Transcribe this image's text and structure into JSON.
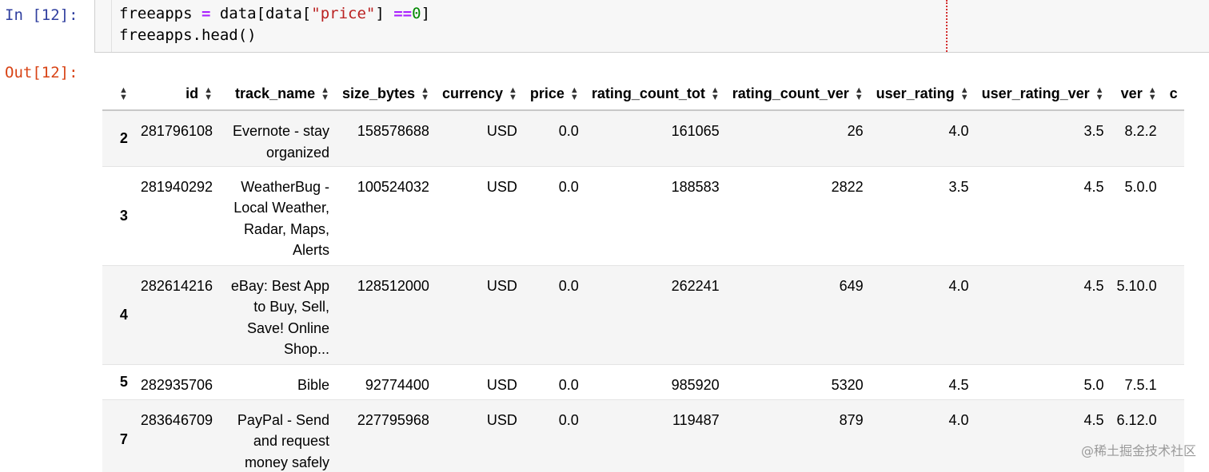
{
  "input_cell": {
    "prompt": "In [12]:",
    "line1": {
      "a": "freeapps ",
      "eq": "=",
      "b": " data[data[",
      "str": "\"price\"",
      "c": "] ",
      "op": "==",
      "num": "0",
      "d": "]"
    },
    "line2": "freeapps.head()"
  },
  "output_cell": {
    "prompt": "Out[12]:",
    "columns": [
      "",
      "id",
      "track_name",
      "size_bytes",
      "currency",
      "price",
      "rating_count_tot",
      "rating_count_ver",
      "user_rating",
      "user_rating_ver",
      "ver",
      "c"
    ],
    "rows": [
      {
        "index": "2",
        "id": "281796108",
        "track_name": "Evernote - stay organized",
        "size_bytes": "158578688",
        "currency": "USD",
        "price": "0.0",
        "rating_count_tot": "161065",
        "rating_count_ver": "26",
        "user_rating": "4.0",
        "user_rating_ver": "3.5",
        "ver": "8.2.2"
      },
      {
        "index": "3",
        "id": "281940292",
        "track_name": "WeatherBug - Local Weather, Radar, Maps, Alerts",
        "size_bytes": "100524032",
        "currency": "USD",
        "price": "0.0",
        "rating_count_tot": "188583",
        "rating_count_ver": "2822",
        "user_rating": "3.5",
        "user_rating_ver": "4.5",
        "ver": "5.0.0"
      },
      {
        "index": "4",
        "id": "282614216",
        "track_name": "eBay: Best App to Buy, Sell, Save! Online Shop...",
        "size_bytes": "128512000",
        "currency": "USD",
        "price": "0.0",
        "rating_count_tot": "262241",
        "rating_count_ver": "649",
        "user_rating": "4.0",
        "user_rating_ver": "4.5",
        "ver": "5.10.0"
      },
      {
        "index": "5",
        "id": "282935706",
        "track_name": "Bible",
        "size_bytes": "92774400",
        "currency": "USD",
        "price": "0.0",
        "rating_count_tot": "985920",
        "rating_count_ver": "5320",
        "user_rating": "4.5",
        "user_rating_ver": "5.0",
        "ver": "7.5.1"
      },
      {
        "index": "7",
        "id": "283646709",
        "track_name": "PayPal - Send and request money safely",
        "size_bytes": "227795968",
        "currency": "USD",
        "price": "0.0",
        "rating_count_tot": "119487",
        "rating_count_ver": "879",
        "user_rating": "4.0",
        "user_rating_ver": "4.5",
        "ver": "6.12.0"
      }
    ]
  },
  "watermark": "@稀土掘金技术社区"
}
